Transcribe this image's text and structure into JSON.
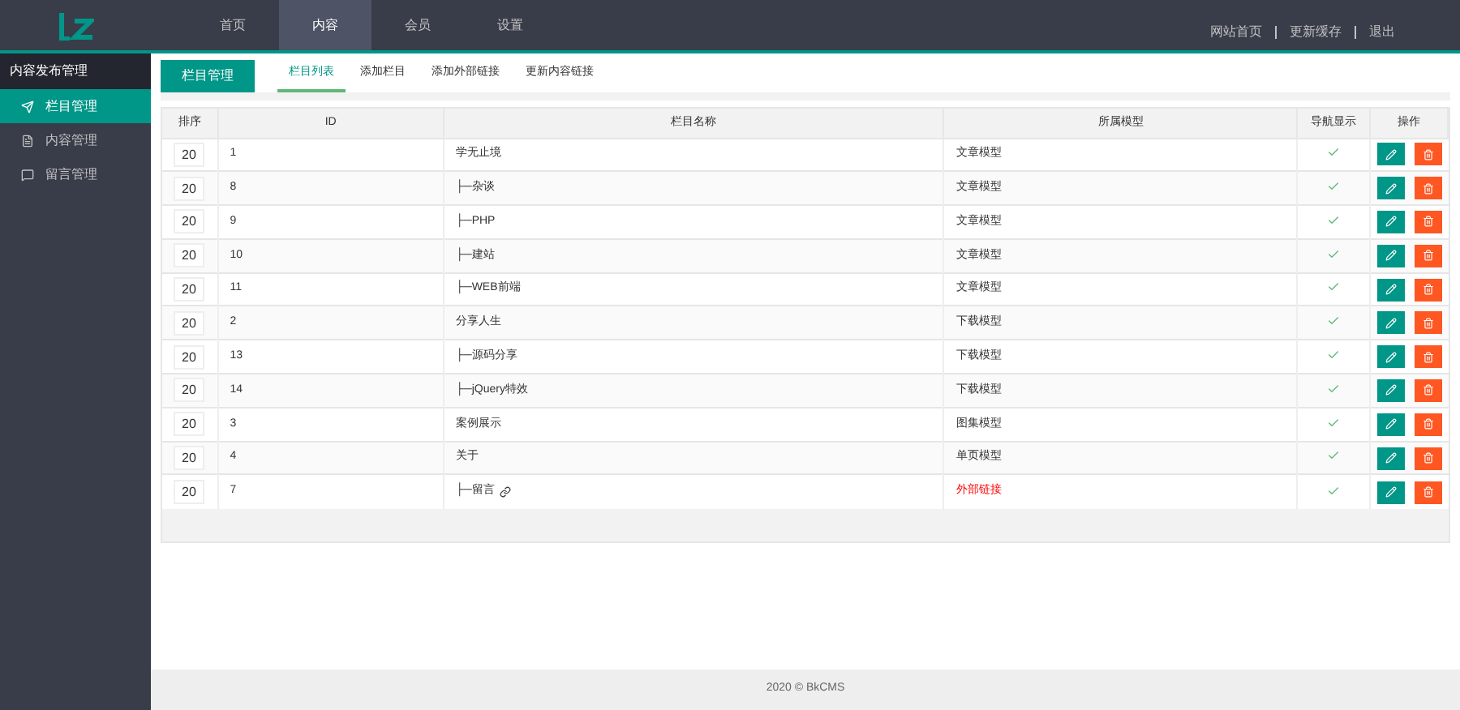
{
  "top_nav": [
    {
      "label": "首页",
      "selected": false
    },
    {
      "label": "内容",
      "selected": true
    },
    {
      "label": "会员",
      "selected": false
    },
    {
      "label": "设置",
      "selected": false
    }
  ],
  "top_links": [
    "网站首页",
    "更新缓存",
    "退出"
  ],
  "sidebar": {
    "title": "内容发布管理",
    "items": [
      {
        "label": "栏目管理",
        "selected": true
      },
      {
        "label": "内容管理",
        "selected": false
      },
      {
        "label": "留言管理",
        "selected": false
      }
    ]
  },
  "section_button": "栏目管理",
  "tabs": [
    {
      "label": "栏目列表",
      "selected": true
    },
    {
      "label": "添加栏目",
      "selected": false
    },
    {
      "label": "添加外部链接",
      "selected": false
    },
    {
      "label": "更新内容链接",
      "selected": false
    }
  ],
  "table": {
    "columns": [
      "排序",
      "ID",
      "栏目名称",
      "所属模型",
      "导航显示",
      "操作"
    ],
    "rows": [
      {
        "sort": "20",
        "id": "1",
        "name": "学无止境",
        "link": false,
        "model": "文章模型",
        "external": false,
        "nav_shown": true
      },
      {
        "sort": "20",
        "id": "8",
        "name": "├─杂谈",
        "link": false,
        "model": "文章模型",
        "external": false,
        "nav_shown": true
      },
      {
        "sort": "20",
        "id": "9",
        "name": "├─PHP",
        "link": false,
        "model": "文章模型",
        "external": false,
        "nav_shown": true
      },
      {
        "sort": "20",
        "id": "10",
        "name": "├─建站",
        "link": false,
        "model": "文章模型",
        "external": false,
        "nav_shown": true
      },
      {
        "sort": "20",
        "id": "11",
        "name": "├─WEB前端",
        "link": false,
        "model": "文章模型",
        "external": false,
        "nav_shown": true
      },
      {
        "sort": "20",
        "id": "2",
        "name": "分享人生",
        "link": false,
        "model": "下载模型",
        "external": false,
        "nav_shown": true
      },
      {
        "sort": "20",
        "id": "13",
        "name": "├─源码分享",
        "link": false,
        "model": "下载模型",
        "external": false,
        "nav_shown": true
      },
      {
        "sort": "20",
        "id": "14",
        "name": "├─jQuery特效",
        "link": false,
        "model": "下载模型",
        "external": false,
        "nav_shown": true
      },
      {
        "sort": "20",
        "id": "3",
        "name": "案例展示",
        "link": false,
        "model": "图集模型",
        "external": false,
        "nav_shown": true
      },
      {
        "sort": "20",
        "id": "4",
        "name": "关于",
        "link": false,
        "model": "单页模型",
        "external": false,
        "nav_shown": true
      },
      {
        "sort": "20",
        "id": "7",
        "name": "├─留言",
        "link": true,
        "model": "外部链接",
        "external": true,
        "nav_shown": true
      }
    ]
  },
  "footer": "2020 © BkCMS"
}
